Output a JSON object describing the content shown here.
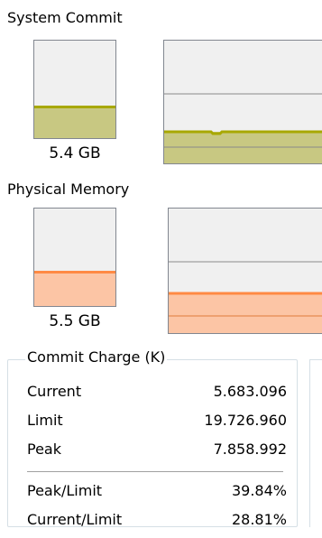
{
  "system_commit": {
    "label": "System Commit",
    "value": "5.4 GB",
    "level_fraction": 0.33,
    "color": "#c8c882",
    "line_color": "#a8a800"
  },
  "physical_memory": {
    "label": "Physical Memory",
    "value": "5.5 GB",
    "level_fraction": 0.36,
    "color": "#fcc5a5",
    "line_color": "#ff8a44"
  },
  "commit_charge": {
    "title": "Commit Charge (K)",
    "rows": [
      {
        "label": "Current",
        "value": "5.683.096"
      },
      {
        "label": "Limit",
        "value": "19.726.960"
      },
      {
        "label": "Peak",
        "value": "7.858.992"
      },
      {
        "label": "Peak/Limit",
        "value": "39.84%"
      },
      {
        "label": "Current/Limit",
        "value": "28.81%"
      }
    ]
  },
  "colors": {
    "panel_bg": "#f0f0f0",
    "border": "#828790",
    "grid": "#8a8a8a"
  }
}
